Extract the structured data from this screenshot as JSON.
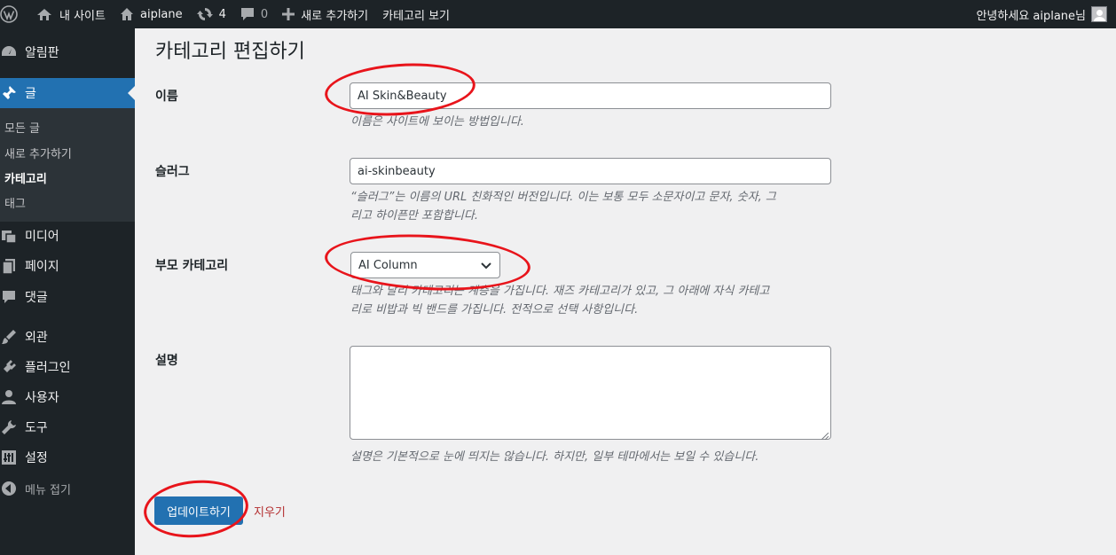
{
  "adminbar": {
    "site_name": "내 사이트",
    "site_label": "aiplane",
    "updates_count": "4",
    "comments_count": "0",
    "add_new": "새로 추가하기",
    "view_category": "카테고리 보기",
    "greeting": "안녕하세요 aiplane님"
  },
  "sidebar": {
    "items": [
      {
        "label": "알림판",
        "icon": "dashboard-icon"
      },
      {
        "label": "글",
        "icon": "pin-icon"
      },
      {
        "label": "미디어",
        "icon": "media-icon"
      },
      {
        "label": "페이지",
        "icon": "page-icon"
      },
      {
        "label": "댓글",
        "icon": "comment-icon"
      },
      {
        "label": "외관",
        "icon": "brush-icon"
      },
      {
        "label": "플러그인",
        "icon": "plugin-icon"
      },
      {
        "label": "사용자",
        "icon": "user-icon"
      },
      {
        "label": "도구",
        "icon": "wrench-icon"
      },
      {
        "label": "설정",
        "icon": "settings-icon"
      },
      {
        "label": "메뉴 접기",
        "icon": "collapse-icon"
      }
    ],
    "submenu": [
      {
        "label": "모든 글"
      },
      {
        "label": "새로 추가하기"
      },
      {
        "label": "카테고리"
      },
      {
        "label": "태그"
      }
    ]
  },
  "main": {
    "title": "카테고리 편집하기",
    "name_label": "이름",
    "name_value": "AI Skin&Beauty",
    "name_desc": "이름은 사이트에 보이는 방법입니다.",
    "slug_label": "슬러그",
    "slug_value": "ai-skinbeauty",
    "slug_desc_line1": "“슬러그”는 이름의 URL 친화적인 버전입니다. 이는 보통 모두 소문자이고 문자, 숫자, 그",
    "slug_desc_line2": "리고 하이픈만 포함합니다.",
    "parent_label": "부모 카테고리",
    "parent_value": "AI Column",
    "parent_desc_line1": "태그와 달리 카테고리는 계층을 가집니다. 재즈 카테고리가 있고, 그 아래에 자식 카테고",
    "parent_desc_line2": "리로 비밥과 빅 밴드를 가집니다. 전적으로 선택 사항입니다.",
    "description_label": "설명",
    "description_desc": "설명은 기본적으로 눈에 띄지는 않습니다. 하지만, 일부 테마에서는 보일 수 있습니다.",
    "update_button": "업데이트하기",
    "delete_link": "지우기"
  },
  "colors": {
    "accent": "#2271b1",
    "adminbar_bg": "#1d2327",
    "annotation": "#e8141b",
    "delete": "#b32d2e"
  }
}
